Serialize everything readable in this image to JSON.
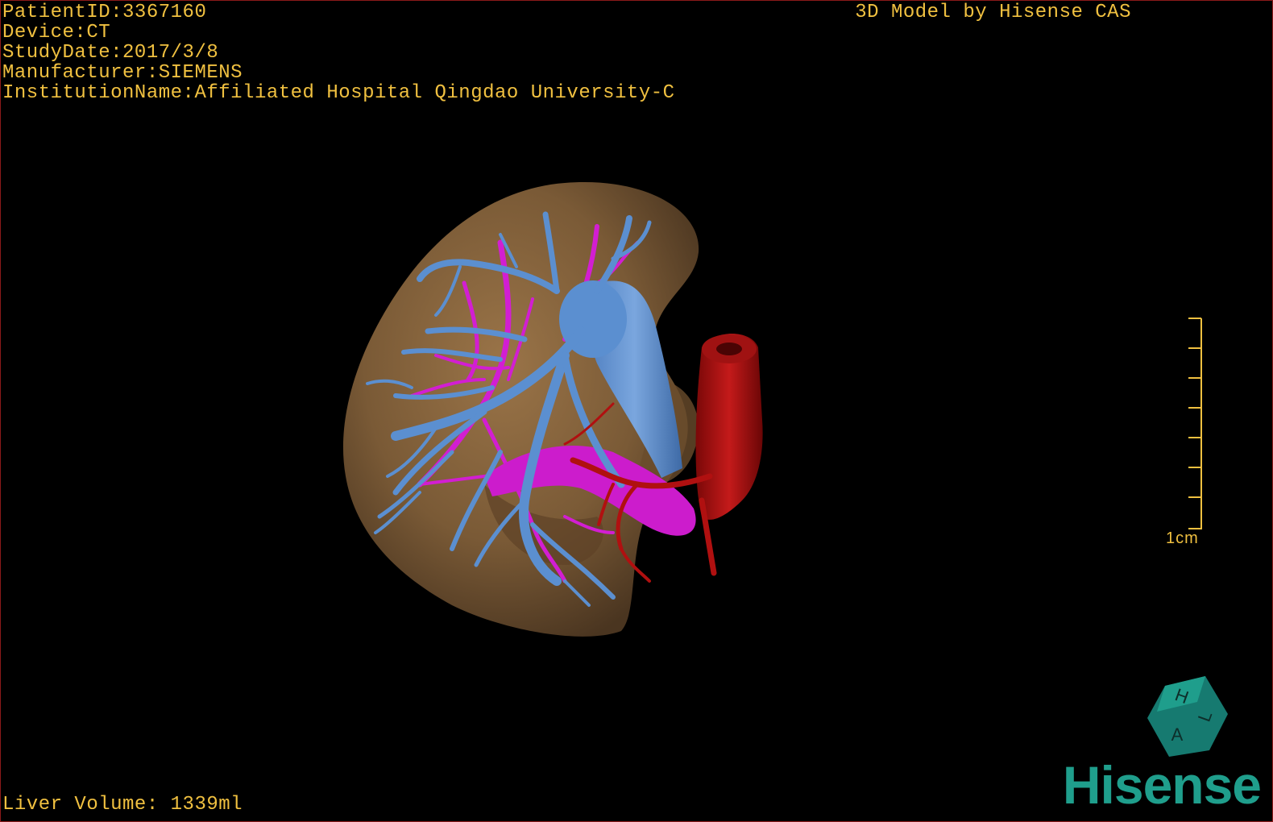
{
  "overlay": {
    "patient_id": "PatientID:3367160",
    "device": "Device:CT",
    "study_date": "StudyDate:2017/3/8",
    "manufacturer": "Manufacturer:SIEMENS",
    "institution": "InstitutionName:Affiliated Hospital Qingdao University-C",
    "model_credit": "3D Model by Hisense CAS",
    "liver_volume": "Liver Volume: 1339ml"
  },
  "scale": {
    "label": "1cm"
  },
  "orientation_cube": {
    "labels": [
      "H",
      "L",
      "A"
    ]
  },
  "brand": {
    "logo_text": "Hisense"
  },
  "colors": {
    "overlay_text": "#f0c040",
    "liver": "#7a5a36",
    "portal_vein": "#5b8fd0",
    "hepatic_vein": "#d21ed2",
    "artery": "#b01010",
    "brand": "#1f9e8c",
    "border": "#8b1a1a"
  },
  "icons": {
    "orientation_cube": "orientation-cube-icon",
    "scale_bar": "scale-bar-icon"
  }
}
